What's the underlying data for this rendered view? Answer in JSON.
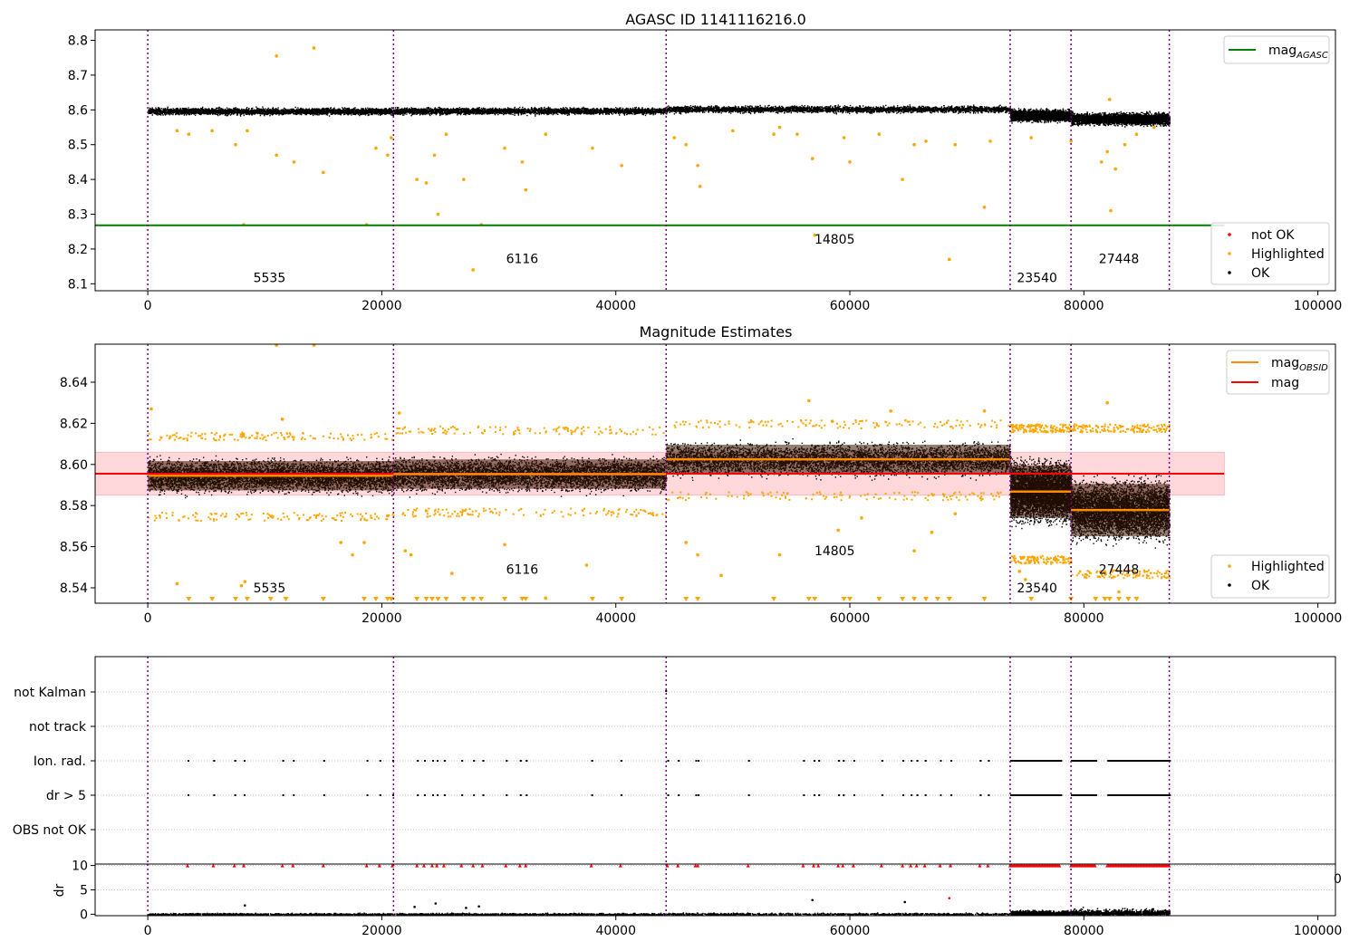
{
  "colors": {
    "ok": "#000000",
    "highlighted": "#ffa500",
    "not_ok": "#ff0000",
    "agasc_line": "#008000",
    "mag_line": "#ff0000",
    "mag_obsid": "#ff8c00",
    "obsid_boundary": "#800080",
    "band": "#ffd8dc"
  },
  "chart_data": [
    {
      "type": "scatter",
      "title": "AGASC ID 1141116216.0",
      "xlim": [
        -4500,
        101500
      ],
      "ylim": [
        8.08,
        8.83
      ],
      "xticks": [
        0,
        20000,
        40000,
        60000,
        80000,
        100000
      ],
      "yticks": [
        8.1,
        8.2,
        8.3,
        8.4,
        8.5,
        8.6,
        8.7,
        8.8
      ],
      "ytick_labels": [
        "8.1",
        "8.2",
        "8.3",
        "8.4",
        "8.5",
        "8.6",
        "8.7",
        "8.8"
      ],
      "legend_top": [
        {
          "label": "mag",
          "sub": "AGASC",
          "kind": "line",
          "color": "#008000"
        }
      ],
      "legend_bottom": [
        {
          "label": "not OK",
          "kind": "dot",
          "color": "#ff0000"
        },
        {
          "label": "Highlighted",
          "kind": "dot",
          "color": "#ffa500"
        },
        {
          "label": "OK",
          "kind": "dot",
          "color": "#000000"
        }
      ],
      "mag_agasc": 8.268,
      "obsid_boundaries": [
        0,
        21000,
        44300,
        73700,
        78900,
        87300
      ],
      "obsid_annotations": [
        {
          "text": "5535",
          "x": 10400,
          "y": 8.105
        },
        {
          "text": "6116",
          "x": 32000,
          "y": 8.16
        },
        {
          "text": "14805",
          "x": 58700,
          "y": 8.215
        },
        {
          "text": "23540",
          "x": 76000,
          "y": 8.105
        },
        {
          "text": "27448",
          "x": 83000,
          "y": 8.16
        }
      ],
      "segments": [
        {
          "x0": 0,
          "x1": 21000,
          "mean": 8.597,
          "spread": 0.012
        },
        {
          "x0": 21000,
          "x1": 44300,
          "mean": 8.598,
          "spread": 0.012
        },
        {
          "x0": 44300,
          "x1": 73700,
          "mean": 8.603,
          "spread": 0.012
        },
        {
          "x0": 73700,
          "x1": 78900,
          "mean": 8.585,
          "spread": 0.02
        },
        {
          "x0": 78900,
          "x1": 87300,
          "mean": 8.575,
          "spread": 0.022
        }
      ],
      "highlighted_points": [
        [
          11000,
          8.755
        ],
        [
          14200,
          8.778
        ],
        [
          2500,
          8.54
        ],
        [
          3500,
          8.53
        ],
        [
          5500,
          8.54
        ],
        [
          7500,
          8.5
        ],
        [
          8500,
          8.54
        ],
        [
          11000,
          8.47
        ],
        [
          12500,
          8.45
        ],
        [
          15000,
          8.42
        ],
        [
          19500,
          8.49
        ],
        [
          20500,
          8.47
        ],
        [
          20800,
          8.52
        ],
        [
          23000,
          8.4
        ],
        [
          23800,
          8.39
        ],
        [
          24500,
          8.47
        ],
        [
          25500,
          8.53
        ],
        [
          27000,
          8.4
        ],
        [
          24800,
          8.3
        ],
        [
          28500,
          8.27
        ],
        [
          27800,
          8.14
        ],
        [
          30500,
          8.49
        ],
        [
          32000,
          8.45
        ],
        [
          32300,
          8.37
        ],
        [
          34000,
          8.53
        ],
        [
          38000,
          8.49
        ],
        [
          40500,
          8.44
        ],
        [
          8200,
          8.27
        ],
        [
          18700,
          8.27
        ],
        [
          45000,
          8.52
        ],
        [
          46000,
          8.5
        ],
        [
          47000,
          8.44
        ],
        [
          47200,
          8.38
        ],
        [
          50000,
          8.54
        ],
        [
          53500,
          8.53
        ],
        [
          54000,
          8.55
        ],
        [
          55500,
          8.53
        ],
        [
          56800,
          8.46
        ],
        [
          57000,
          8.24
        ],
        [
          59500,
          8.52
        ],
        [
          60000,
          8.45
        ],
        [
          62500,
          8.53
        ],
        [
          64500,
          8.4
        ],
        [
          65500,
          8.5
        ],
        [
          66500,
          8.51
        ],
        [
          68500,
          8.17
        ],
        [
          69000,
          8.5
        ],
        [
          71500,
          8.32
        ],
        [
          72000,
          8.51
        ],
        [
          75500,
          8.52
        ],
        [
          78900,
          8.51
        ],
        [
          81500,
          8.45
        ],
        [
          82000,
          8.48
        ],
        [
          82300,
          8.31
        ],
        [
          82700,
          8.43
        ],
        [
          83500,
          8.5
        ],
        [
          84500,
          8.53
        ],
        [
          86000,
          8.55
        ],
        [
          82200,
          8.63
        ]
      ]
    },
    {
      "type": "scatter",
      "title": "Magnitude Estimates",
      "xlim": [
        -4500,
        101500
      ],
      "ylim": [
        8.5325,
        8.6585
      ],
      "xticks": [
        0,
        20000,
        40000,
        60000,
        80000,
        100000
      ],
      "yticks": [
        8.54,
        8.56,
        8.58,
        8.6,
        8.62,
        8.64
      ],
      "ytick_labels": [
        "8.54",
        "8.56",
        "8.58",
        "8.60",
        "8.62",
        "8.64"
      ],
      "legend_top": [
        {
          "label": "mag",
          "sub": "OBSID",
          "kind": "line",
          "color": "#ff8c00"
        },
        {
          "label": "mag",
          "kind": "line",
          "color": "#ff0000"
        }
      ],
      "legend_bottom": [
        {
          "label": "Highlighted",
          "kind": "dot",
          "color": "#ffa500"
        },
        {
          "label": "OK",
          "kind": "dot",
          "color": "#000000"
        }
      ],
      "mag": 8.5955,
      "mag_band": [
        8.585,
        8.606
      ],
      "band_x": [
        -4500,
        92000
      ],
      "obsid_boundaries": [
        0,
        21000,
        44300,
        73700,
        78900,
        87300
      ],
      "obsid_annotations": [
        {
          "text": "5535",
          "x": 10400,
          "y": 8.5378
        },
        {
          "text": "6116",
          "x": 32000,
          "y": 8.5468
        },
        {
          "text": "14805",
          "x": 58700,
          "y": 8.5558
        },
        {
          "text": "23540",
          "x": 76000,
          "y": 8.5378
        },
        {
          "text": "27448",
          "x": 83000,
          "y": 8.5468
        }
      ],
      "mag_obsid": [
        {
          "x0": 0,
          "x1": 21000,
          "mag": 8.5945
        },
        {
          "x0": 21000,
          "x1": 44300,
          "mag": 8.5953
        },
        {
          "x0": 44300,
          "x1": 73700,
          "mag": 8.6025
        },
        {
          "x0": 73700,
          "x1": 78900,
          "mag": 8.5868
        },
        {
          "x0": 78900,
          "x1": 87300,
          "mag": 8.5778
        }
      ],
      "segments": [
        {
          "x0": 0,
          "x1": 21000,
          "mean": 8.5945,
          "spread": 0.0095,
          "hl_top": 8.616,
          "hl_bot": 8.573
        },
        {
          "x0": 21000,
          "x1": 44300,
          "mean": 8.5953,
          "spread": 0.0095,
          "hl_top": 8.619,
          "hl_bot": 8.575
        },
        {
          "x0": 44300,
          "x1": 73700,
          "mean": 8.6025,
          "spread": 0.0095,
          "hl_top": 8.622,
          "hl_bot": 8.583
        },
        {
          "x0": 73700,
          "x1": 78900,
          "mean": 8.5868,
          "spread": 0.017,
          "hl_top": 8.62,
          "hl_bot": 8.552
        },
        {
          "x0": 78900,
          "x1": 87300,
          "mean": 8.5778,
          "spread": 0.017,
          "hl_top": 8.62,
          "hl_bot": 8.545
        }
      ],
      "highlighted_points": [
        [
          11000,
          8.658
        ],
        [
          14200,
          8.658
        ],
        [
          300,
          8.627
        ],
        [
          2500,
          8.542
        ],
        [
          8300,
          8.543
        ],
        [
          8000,
          8.541
        ],
        [
          11500,
          8.622
        ],
        [
          16500,
          8.562
        ],
        [
          18500,
          8.562
        ],
        [
          17500,
          8.556
        ],
        [
          20500,
          8.575
        ],
        [
          21500,
          8.625
        ],
        [
          22500,
          8.556
        ],
        [
          22000,
          8.558
        ],
        [
          26000,
          8.547
        ],
        [
          30500,
          8.561
        ],
        [
          34000,
          8.535
        ],
        [
          37500,
          8.551
        ],
        [
          46000,
          8.562
        ],
        [
          47000,
          8.556
        ],
        [
          49000,
          8.546
        ],
        [
          54000,
          8.556
        ],
        [
          56500,
          8.631
        ],
        [
          58500,
          8.621
        ],
        [
          59000,
          8.568
        ],
        [
          61000,
          8.574
        ],
        [
          63500,
          8.626
        ],
        [
          65500,
          8.558
        ],
        [
          67000,
          8.567
        ],
        [
          69000,
          8.576
        ],
        [
          71500,
          8.626
        ],
        [
          74500,
          8.548
        ],
        [
          75000,
          8.544
        ],
        [
          82000,
          8.63
        ],
        [
          83000,
          8.538
        ]
      ],
      "below_range_markers": [
        3500,
        5500,
        7500,
        8500,
        10500,
        11800,
        15000,
        18500,
        19500,
        20500,
        20800,
        23000,
        23800,
        24300,
        24800,
        25500,
        27000,
        27800,
        28500,
        30500,
        32000,
        32300,
        38000,
        40500,
        46000,
        47000,
        53500,
        56500,
        57000,
        59500,
        60000,
        62500,
        64500,
        65500,
        66500,
        67500,
        68500,
        71500,
        75500,
        78900,
        81000,
        81800,
        82200,
        83000,
        83800,
        84500
      ]
    },
    {
      "type": "scatter",
      "title": "",
      "flag_labels": [
        "not Kalman",
        "not track",
        "Ion. rad.",
        "dr > 5",
        "OBS not OK"
      ],
      "obsid_boundaries": [
        0,
        21000,
        44300,
        73700,
        78900,
        87300
      ],
      "xlim": [
        -4500,
        101500
      ],
      "flag_events": [
        3400,
        5600,
        7400,
        8200,
        11500,
        12400,
        15000,
        18700,
        19800,
        20900,
        23000,
        23600,
        24300,
        24700,
        25300,
        26800,
        27800,
        28600,
        30600,
        31800,
        32300,
        37900,
        40400,
        44400,
        45300,
        46800,
        47000,
        51300,
        56000,
        56900,
        57300,
        59000,
        59400,
        60300,
        62700,
        64500,
        65200,
        65700,
        66400,
        67700,
        68600,
        71100,
        71800
      ],
      "flag_dense_ranges": [
        [
          73700,
          78000
        ],
        [
          78900,
          81000
        ],
        [
          82000,
          87300
        ]
      ],
      "not_kalman_events": [
        44300
      ]
    },
    {
      "type": "scatter",
      "title": "",
      "ylabel": "dr",
      "xlim": [
        -4500,
        101500
      ],
      "ylim": [
        -0.3,
        10.3
      ],
      "xticks": [
        0,
        20000,
        40000,
        60000,
        80000,
        100000
      ],
      "yticks": [
        0,
        5,
        10
      ],
      "ytick_labels": [
        "0",
        "5",
        "10"
      ],
      "obsid_boundaries": [
        0,
        21000,
        44300,
        73700,
        78900,
        87300
      ],
      "clipped_markers": [
        3400,
        5600,
        7400,
        8200,
        11500,
        12400,
        15000,
        18700,
        19800,
        20900,
        23000,
        23600,
        24300,
        24700,
        25300,
        26800,
        27800,
        28600,
        30600,
        31800,
        32300,
        37900,
        40400,
        44400,
        45300,
        46800,
        47000,
        51300,
        56000,
        56900,
        57300,
        59000,
        59400,
        60300,
        62700,
        64500,
        65200,
        65700,
        66400,
        67700,
        68600,
        71100,
        71800
      ],
      "clipped_dense_ranges": [
        [
          73700,
          78000
        ],
        [
          78900,
          81000
        ],
        [
          82000,
          87300
        ]
      ],
      "outlier_points": [
        [
          8300,
          1.8
        ],
        [
          22800,
          1.5
        ],
        [
          24600,
          2.2
        ],
        [
          27200,
          1.3
        ],
        [
          28300,
          1.6
        ],
        [
          56800,
          2.9
        ],
        [
          64700,
          2.5
        ]
      ],
      "notok_points": [
        [
          68500,
          3.3
        ]
      ],
      "edge_text": "0"
    }
  ]
}
